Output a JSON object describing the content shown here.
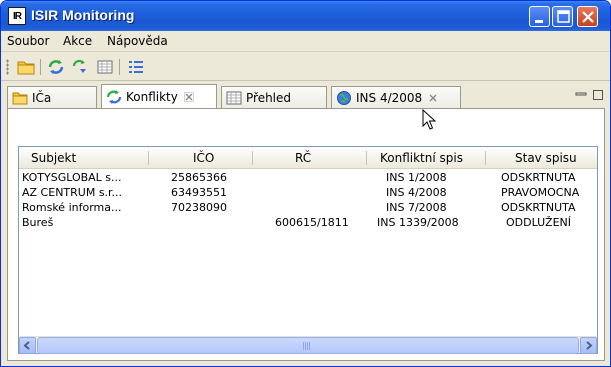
{
  "window": {
    "title": "ISIR Monitoring",
    "icon_text": "IR"
  },
  "menu": [
    "Soubor",
    "Akce",
    "Nápověda"
  ],
  "toolbar": {
    "icons": [
      "folder-icon",
      "refresh-icon",
      "refresh-arrow-icon",
      "grid-icon",
      "list-icon"
    ]
  },
  "tabs": [
    {
      "label": "IČa",
      "icon": "folder-icon"
    },
    {
      "label": "Konflikty",
      "icon": "refresh-icon",
      "active": true,
      "closable": true
    },
    {
      "label": "Přehled",
      "icon": "grid-icon"
    },
    {
      "label": "INS 4/2008",
      "icon": "globe-icon",
      "closable": true
    }
  ],
  "table": {
    "columns": [
      "Subjekt",
      "IČO",
      "RČ",
      "Konfliktní spis",
      "Stav spisu"
    ],
    "rows": [
      [
        "KOTYSGLOBAL s...",
        "25865366",
        "",
        "INS 1/2008",
        "ODSKRTNUTA"
      ],
      [
        "AZ CENTRUM s.r...",
        "63493551",
        "",
        "INS 4/2008",
        "PRAVOMOCNA"
      ],
      [
        "Romské informa...",
        "70238090",
        "",
        "INS 7/2008",
        "ODSKRTNUTA"
      ],
      [
        "Bureš",
        "",
        "600615/1811",
        "INS 1339/2008",
        "ODDLUŽENÍ"
      ]
    ]
  },
  "colors": {
    "titlebar": "#1f5fdc",
    "window_bg": "#ece9d8",
    "close_button": "#c8401f"
  }
}
